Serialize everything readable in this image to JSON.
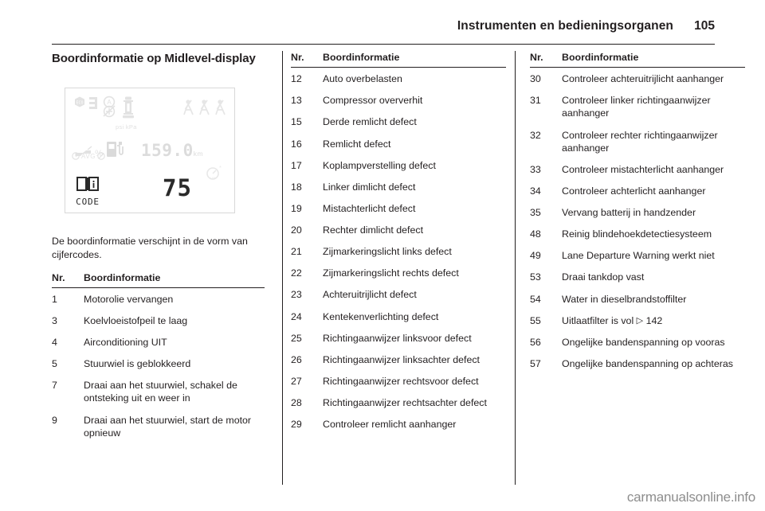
{
  "header": {
    "title": "Instrumenten en bedieningsorganen",
    "page_number": "105"
  },
  "section": {
    "title": "Boordinformatie op Midlevel-display",
    "intro": "De boordinformatie verschijnt in de vorm van cijfercodes."
  },
  "figure": {
    "alt": "Midlevel-display met boordinformatie",
    "psi_kpa_label": "psi kPa",
    "avg_label": "AVG",
    "distance_value": "159.0",
    "distance_unit": "km",
    "code_label": "CODE",
    "code_number": "75"
  },
  "table_headers": {
    "nr": "Nr.",
    "info": "Boordinformatie"
  },
  "columns": [
    {
      "rows": [
        {
          "nr": "1",
          "desc": "Motorolie vervangen"
        },
        {
          "nr": "3",
          "desc": "Koelvloeistofpeil te laag"
        },
        {
          "nr": "4",
          "desc": "Airconditioning UIT"
        },
        {
          "nr": "5",
          "desc": "Stuurwiel is geblokkeerd"
        },
        {
          "nr": "7",
          "desc": "Draai aan het stuurwiel, schakel de ontsteking uit en weer in"
        },
        {
          "nr": "9",
          "desc": "Draai aan het stuurwiel, start de motor opnieuw"
        }
      ]
    },
    {
      "rows": [
        {
          "nr": "12",
          "desc": "Auto overbelasten"
        },
        {
          "nr": "13",
          "desc": "Compressor oververhit"
        },
        {
          "nr": "15",
          "desc": "Derde remlicht defect"
        },
        {
          "nr": "16",
          "desc": "Remlicht defect"
        },
        {
          "nr": "17",
          "desc": "Koplampverstelling defect"
        },
        {
          "nr": "18",
          "desc": "Linker dimlicht defect"
        },
        {
          "nr": "19",
          "desc": "Mistachterlicht defect"
        },
        {
          "nr": "20",
          "desc": "Rechter dimlicht defect"
        },
        {
          "nr": "21",
          "desc": "Zijmarkeringslicht links defect"
        },
        {
          "nr": "22",
          "desc": "Zijmarkeringslicht rechts defect"
        },
        {
          "nr": "23",
          "desc": "Achteruitrijlicht defect"
        },
        {
          "nr": "24",
          "desc": "Kentekenverlichting defect"
        },
        {
          "nr": "25",
          "desc": "Richtingaanwijzer linksvoor defect"
        },
        {
          "nr": "26",
          "desc": "Richtingaanwijzer linksachter defect"
        },
        {
          "nr": "27",
          "desc": "Richtingaanwijzer rechtsvoor defect"
        },
        {
          "nr": "28",
          "desc": "Richtingaanwijzer rechtsachter defect"
        },
        {
          "nr": "29",
          "desc": "Controleer remlicht aanhanger"
        }
      ]
    },
    {
      "rows": [
        {
          "nr": "30",
          "desc": "Controleer achteruitrijlicht aanhanger"
        },
        {
          "nr": "31",
          "desc": "Controleer linker richtingaanwijzer aanhanger"
        },
        {
          "nr": "32",
          "desc": "Controleer rechter richtingaanwijzer aanhanger"
        },
        {
          "nr": "33",
          "desc": "Controleer mistachterlicht aanhanger"
        },
        {
          "nr": "34",
          "desc": "Controleer achterlicht aanhanger"
        },
        {
          "nr": "35",
          "desc": "Vervang batterij in handzender"
        },
        {
          "nr": "48",
          "desc": "Reinig blindehoekdetectiesysteem"
        },
        {
          "nr": "49",
          "desc": "Lane Departure Warning werkt niet"
        },
        {
          "nr": "53",
          "desc": "Draai tankdop vast"
        },
        {
          "nr": "54",
          "desc": "Water in dieselbrandstoffilter"
        },
        {
          "nr": "55",
          "desc": "Uitlaatfilter is vol 3 142",
          "ref": {
            "arrow": "▷",
            "target": "142",
            "prefix": "Uitlaatfilter is vol"
          }
        },
        {
          "nr": "56",
          "desc": "Ongelijke bandenspanning op vooras"
        },
        {
          "nr": "57",
          "desc": "Ongelijke bandenspanning op achteras"
        }
      ]
    }
  ],
  "footer": {
    "watermark": "carmanualsonline.info"
  }
}
